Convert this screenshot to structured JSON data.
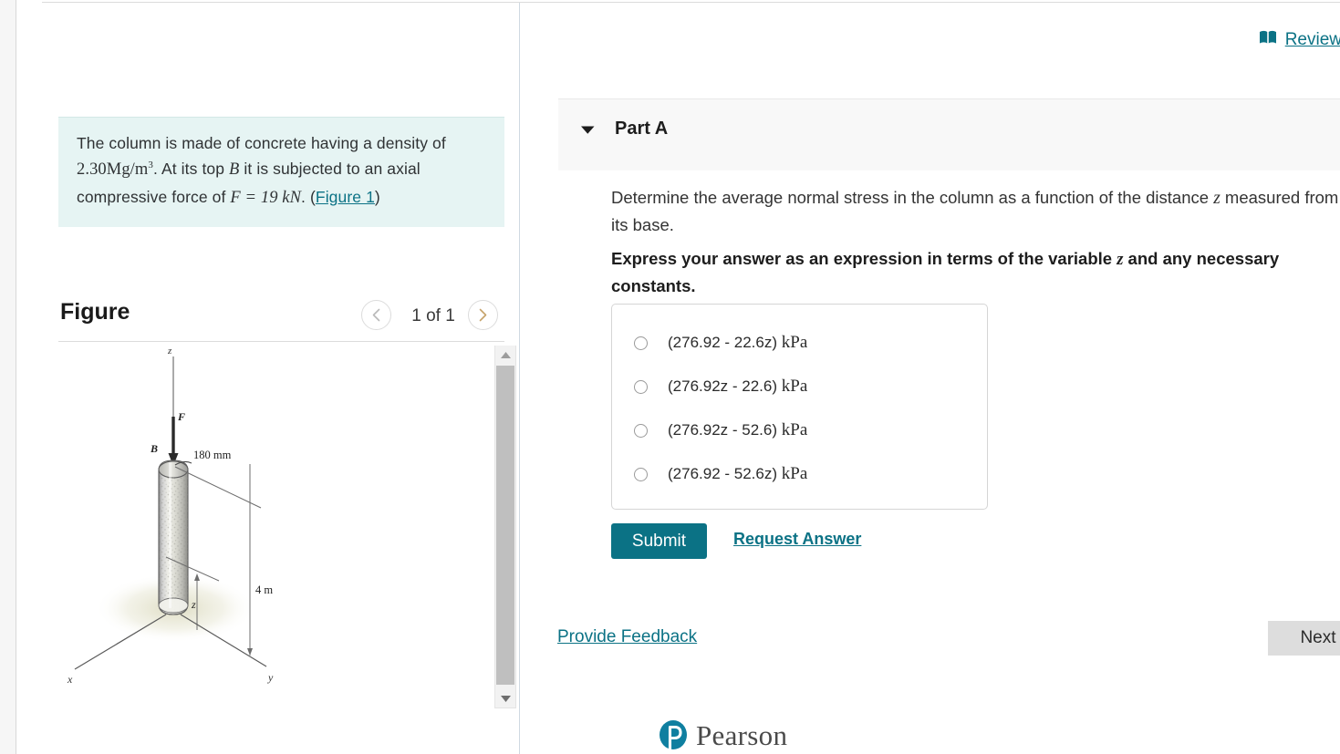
{
  "left": {
    "problem": {
      "line1_a": "The column is made of concrete having a density of",
      "density_value": "2.30",
      "density_units": "Mg/m",
      "density_exp": "3",
      "line2_b": ". At its top ",
      "point_label": "B",
      "line2_c": " it is subjected to an axial",
      "line3_a": "compressive force of ",
      "force_expr": "F = 19 kN",
      "line3_b": ". (",
      "figure_link": "Figure 1",
      "line3_c": ")"
    },
    "figure": {
      "title": "Figure",
      "counter": "1 of 1",
      "prev_icon": "chevron-left-icon",
      "next_icon": "chevron-right-icon",
      "scroll_up_icon": "scroll-up-arrow-icon",
      "scroll_down_icon": "scroll-down-arrow-icon",
      "diagram_labels": {
        "z_axis_top": "z",
        "force": "F",
        "point_b": "B",
        "diameter": "180 mm",
        "height": "4 m",
        "z_dimension": "z",
        "x_axis": "x",
        "y_axis": "y"
      }
    }
  },
  "right": {
    "review": {
      "label": "Review",
      "icon": "book-icon"
    },
    "part": {
      "label": "Part A",
      "caret_icon": "caret-down-icon"
    },
    "prompt": {
      "text_a": "Determine the average normal stress in the column as a function of the distance ",
      "var_z": "z",
      "text_b": " measured from its base.",
      "bold_a": "Express your answer as an expression in terms of the variable ",
      "bold_var": "z",
      "bold_b": " and any necessary constants."
    },
    "choices": [
      {
        "number": "(276.92 - 22.6z)",
        "unit": "kPa",
        "selected": false
      },
      {
        "number": "(276.92z - 22.6)",
        "unit": "kPa",
        "selected": false
      },
      {
        "number": "(276.92z - 52.6)",
        "unit": "kPa",
        "selected": false
      },
      {
        "number": "(276.92 - 52.6z)",
        "unit": "kPa",
        "selected": false
      }
    ],
    "submit_label": "Submit",
    "request_answer_label": "Request Answer",
    "provide_feedback_label": "Provide Feedback",
    "next_label": "Next",
    "footer_brand": "Pearson"
  },
  "colors": {
    "accent_teal": "#0b7285",
    "problem_bg": "#e6f4f3",
    "part_header_bg": "#f8f8f8",
    "next_btn_bg": "#dddddd"
  }
}
